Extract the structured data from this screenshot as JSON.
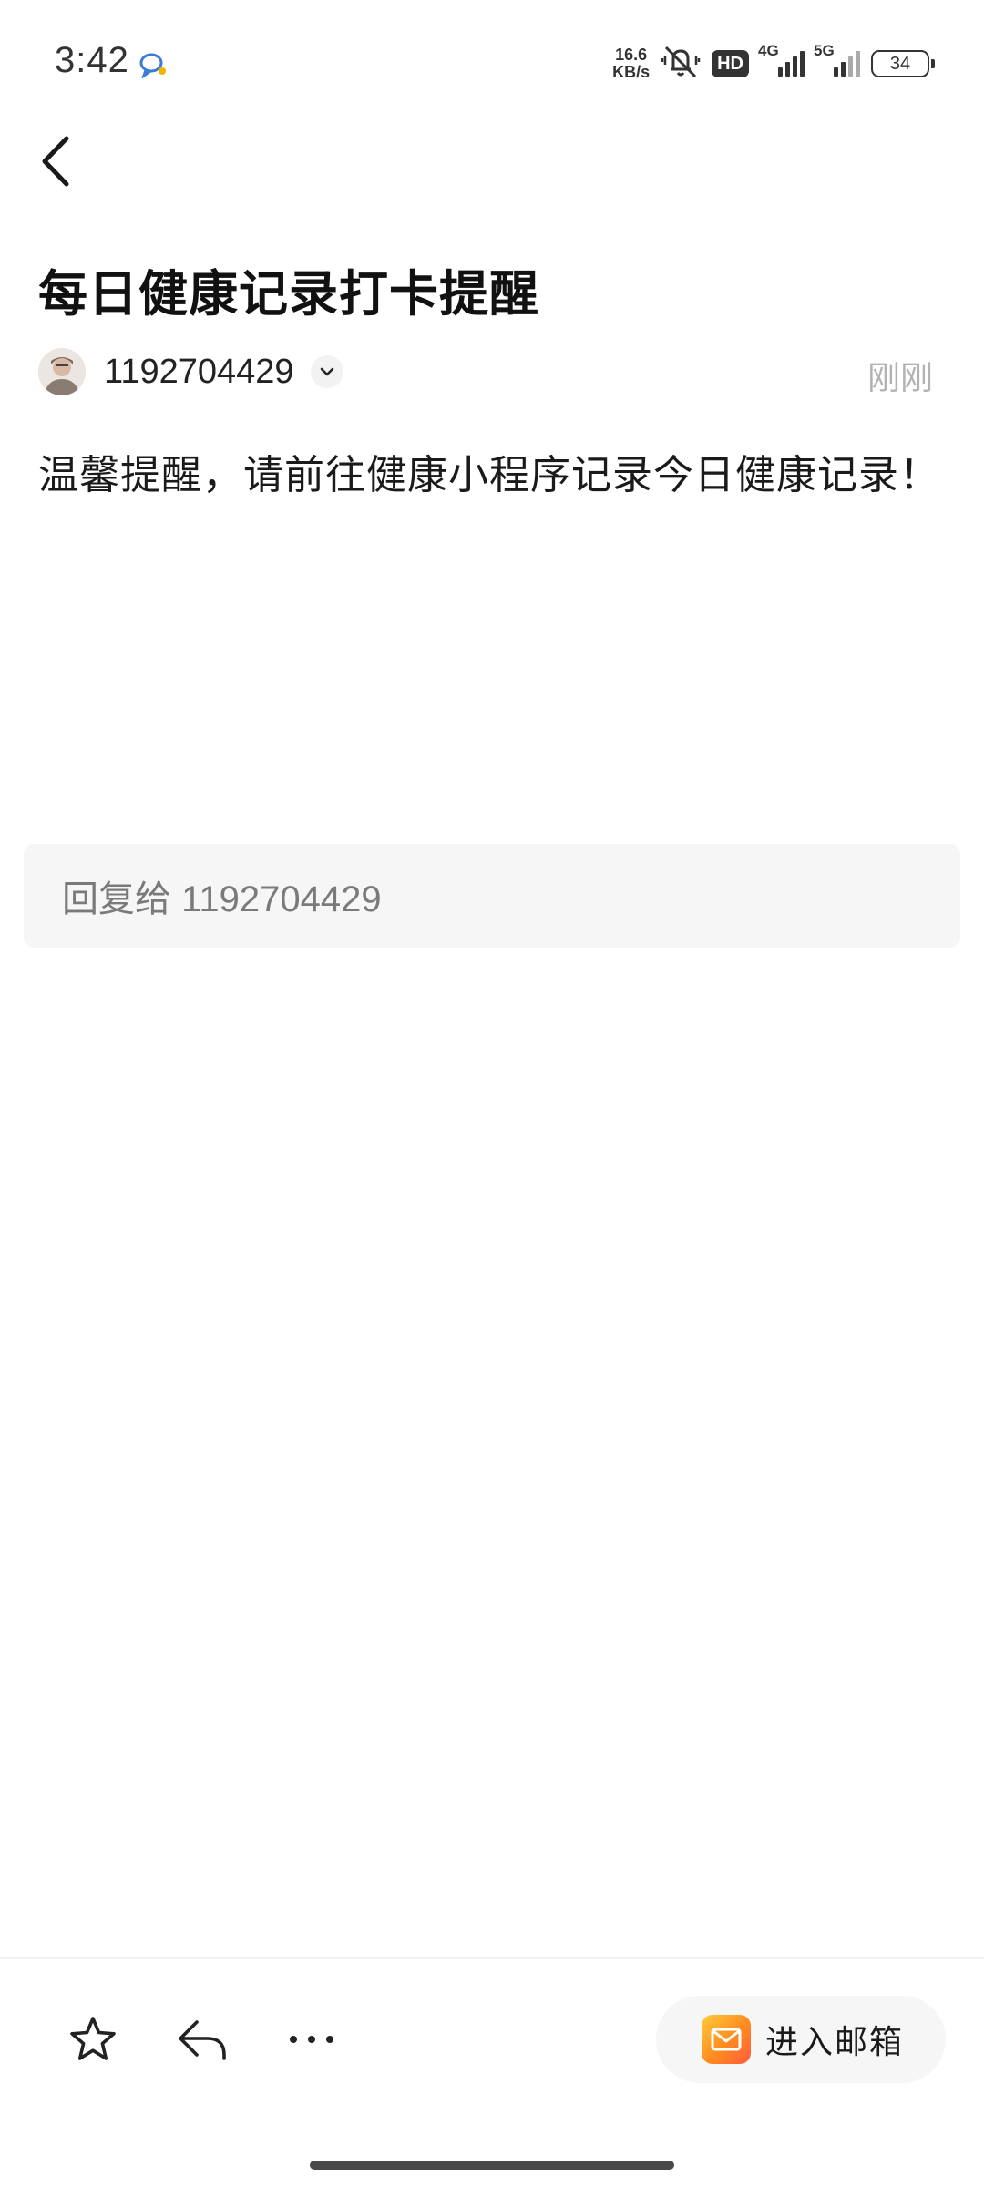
{
  "status_bar": {
    "time": "3:42",
    "net_speed_value": "16.6",
    "net_speed_unit": "KB/s",
    "hd_badge": "HD",
    "network_1": "4G",
    "network_2": "5G",
    "battery": "34"
  },
  "mail": {
    "title": "每日健康记录打卡提醒",
    "sender": "1192704429",
    "time": "刚刚",
    "body": "温馨提醒，请前往健康小程序记录今日健康记录！"
  },
  "reply": {
    "placeholder": "回复给 1192704429"
  },
  "bottom_bar": {
    "enter_mailbox": "进入邮箱"
  },
  "icons": {
    "back": "back-arrow-icon",
    "star": "star-icon",
    "reply": "reply-icon",
    "more": "more-icon",
    "mail": "mail-icon",
    "dropdown": "chevron-down-icon"
  }
}
